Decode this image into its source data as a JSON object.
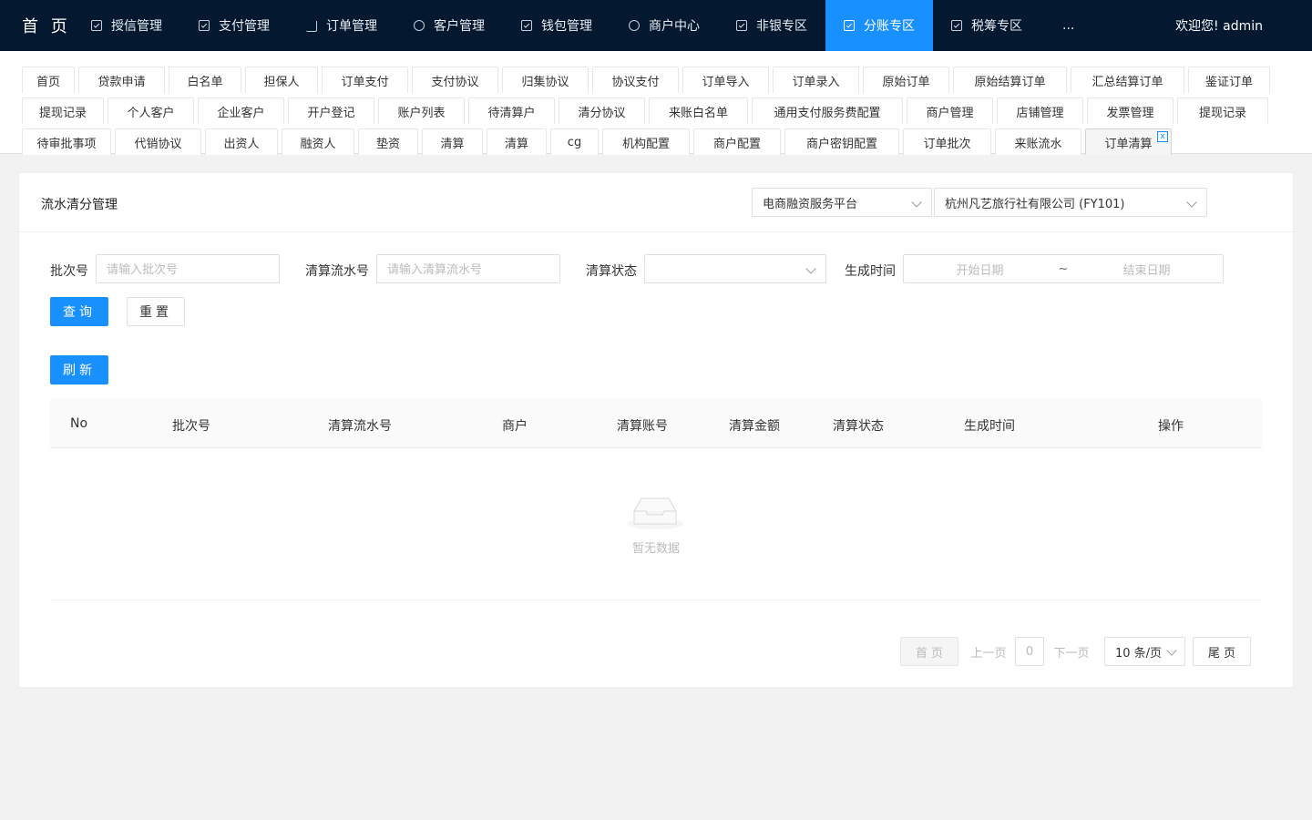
{
  "topnav": {
    "brand": "首 页",
    "items": [
      {
        "label": "授信管理",
        "icon": "document-check-icon"
      },
      {
        "label": "支付管理",
        "icon": "document-check-icon"
      },
      {
        "label": "订单管理",
        "icon": "cart-icon"
      },
      {
        "label": "客户管理",
        "icon": "user-icon"
      },
      {
        "label": "钱包管理",
        "icon": "document-check-icon"
      },
      {
        "label": "商户中心",
        "icon": "clock-icon"
      },
      {
        "label": "非银专区",
        "icon": "document-check-icon"
      },
      {
        "label": "分账专区",
        "icon": "document-check-icon",
        "active": true
      },
      {
        "label": "税筹专区",
        "icon": "document-check-icon"
      }
    ],
    "more": "...",
    "welcome": "欢迎您! admin"
  },
  "tabs": {
    "row1": [
      "首页",
      "贷款申请",
      "白名单",
      "担保人",
      "订单支付",
      "支付协议",
      "归集协议",
      "协议支付",
      "订单导入",
      "订单录入",
      "原始订单",
      "原始结算订单",
      "汇总结算订单",
      "鉴证订单"
    ],
    "row2": [
      "提现记录",
      "个人客户",
      "企业客户",
      "开户登记",
      "账户列表",
      "待清算户",
      "清分协议",
      "来账白名单",
      "通用支付服务费配置",
      "商户管理",
      "店铺管理",
      "发票管理",
      "提现记录"
    ],
    "row3": [
      "待审批事项",
      "代销协议",
      "出资人",
      "融资人",
      "垫资",
      "清算",
      "清算",
      "cg",
      "机构配置",
      "商户配置",
      "商户密钥配置",
      "订单批次",
      "来账流水",
      "订单清算"
    ],
    "active": "订单清算",
    "close_glyph": "x"
  },
  "page": {
    "title": "流水清分管理",
    "platform_select": "电商融资服务平台",
    "merchant_select": "杭州凡艺旅行社有限公司 (FY101)"
  },
  "filters": {
    "batch_label": "批次号",
    "batch_placeholder": "请输入批次号",
    "serial_label": "清算流水号",
    "serial_placeholder": "请输入清算流水号",
    "status_label": "清算状态",
    "status_value": "",
    "time_label": "生成时间",
    "start_placeholder": "开始日期",
    "range_sep": "~",
    "end_placeholder": "结束日期"
  },
  "buttons": {
    "query": "查询",
    "reset": "重置",
    "refresh": "刷新"
  },
  "table": {
    "columns": [
      "No",
      "批次号",
      "清算流水号",
      "商户",
      "清算账号",
      "清算金额",
      "清算状态",
      "生成时间",
      "操作"
    ],
    "rows": [],
    "empty_text": "暂无数据"
  },
  "pagination": {
    "first": "首 页",
    "prev": "上一页",
    "current": "0",
    "next": "下一页",
    "page_size": "10 条/页",
    "last": "尾 页"
  }
}
